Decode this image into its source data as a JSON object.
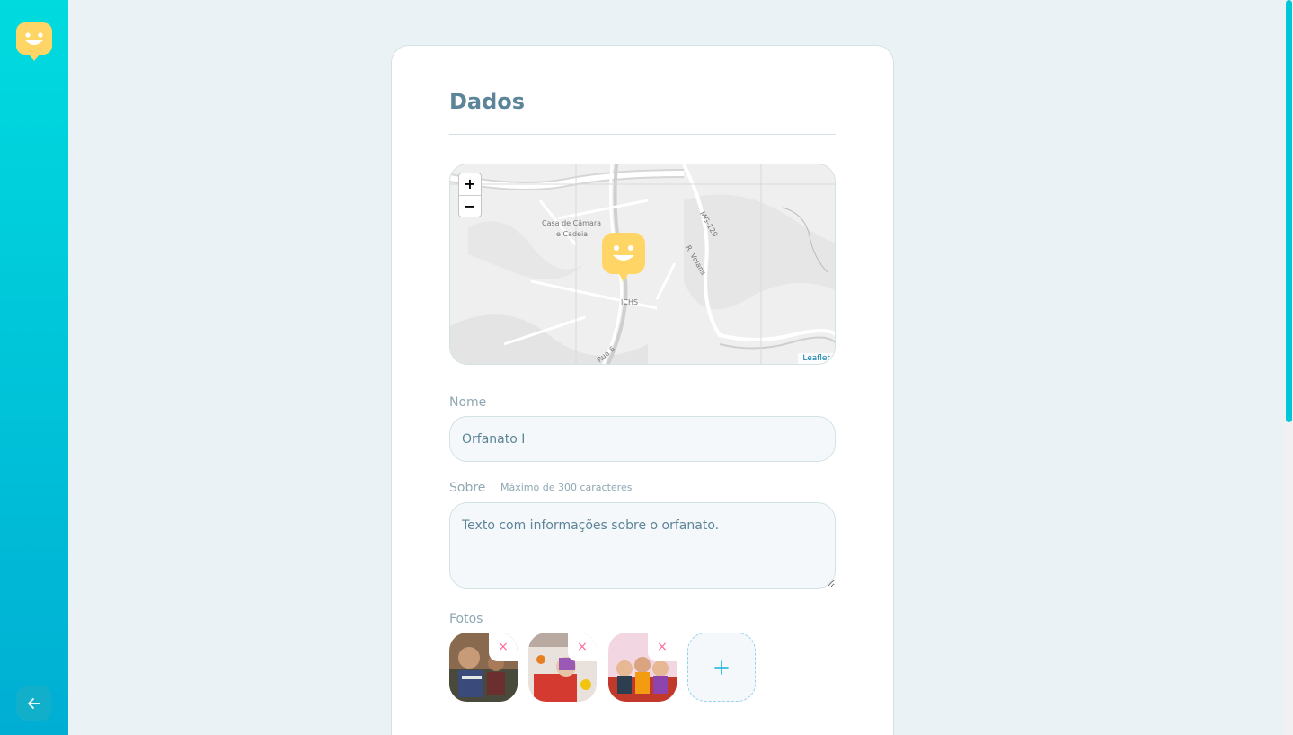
{
  "sidebar": {
    "logo_icon": "happy-marker-icon",
    "back_icon": "arrow-left-icon"
  },
  "form": {
    "title": "Dados",
    "map": {
      "zoom_in": "+",
      "zoom_out": "−",
      "attribution": "Leaflet",
      "place_labels": [
        "Casa de Câmara",
        "e Cadeia",
        "MG-129",
        "R. Volans",
        "ICHS",
        "Rua 6"
      ]
    },
    "name": {
      "label": "Nome",
      "value": "Orfanato I"
    },
    "about": {
      "label": "Sobre",
      "hint": "Máximo de 300 caracteres",
      "value": "Texto com informações sobre o orfanato."
    },
    "photos": {
      "label": "Fotos",
      "remove_symbol": "×",
      "add_icon": "plus-icon",
      "count": 3
    }
  },
  "colors": {
    "sidebar_top": "#00dbdf",
    "sidebar_bottom": "#00aed3",
    "title": "#5c8599",
    "accent_yellow": "#ffd666",
    "remove": "#ff669d"
  }
}
